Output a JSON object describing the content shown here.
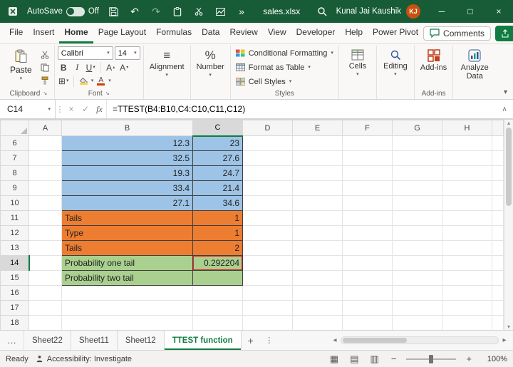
{
  "colors": {
    "title_green": "#185C37",
    "accent_green": "#107C41",
    "blue_fill": "#9DC3E6",
    "orange_fill": "#ED7D31",
    "green_fill": "#A9D08E",
    "highlight_red": "#ED1C24"
  },
  "icons": {
    "undo": "↶",
    "redo": "↷",
    "more_commands": "»",
    "chevron": "▾",
    "tri_up": "▴",
    "dots": "⋮",
    "ellipsis": "…",
    "plus": "+",
    "minus": "−",
    "arrow_left": "◂",
    "arrow_right": "▸",
    "check": "✓",
    "cancel": "×",
    "fx": "fx",
    "expand": "∧",
    "bold": "B",
    "italic": "I",
    "underline": "U",
    "borders": "⊞",
    "percent": "%",
    "align": "≡",
    "font_color": "A",
    "grow_font": "A",
    "shrink_font": "A",
    "launcher": "↘",
    "view_normal": "▦",
    "view_layout": "▤",
    "view_break": "▥",
    "minimize": "─",
    "maximize": "□",
    "close": "×"
  },
  "title_bar": {
    "autosave_label": "AutoSave",
    "autosave_state": "Off",
    "file_name": "sales.xlsx",
    "user_name": "Kunal Jai Kaushik",
    "user_initials": "KJ"
  },
  "ribbon_tabs": {
    "items": [
      "File",
      "Insert",
      "Home",
      "Page Layout",
      "Formulas",
      "Data",
      "Review",
      "View",
      "Developer",
      "Help",
      "Power Pivot"
    ],
    "active": "Home",
    "comments_label": "Comments"
  },
  "ribbon": {
    "paste": "Paste",
    "clipboard_group": "Clipboard",
    "font_name": "Calibri",
    "font_size": "14",
    "font_group": "Font",
    "alignment": "Alignment",
    "number": "Number",
    "conditional_formatting": "Conditional Formatting",
    "format_as_table": "Format as Table",
    "cell_styles": "Cell Styles",
    "styles_group": "Styles",
    "cells": "Cells",
    "editing": "Editing",
    "add_ins": "Add-ins",
    "add_ins_group": "Add-ins",
    "analyze_data": "Analyze Data"
  },
  "formula_bar": {
    "name_box": "C14",
    "formula": "=TTEST(B4:B10,C4:C10,C11,C12)"
  },
  "grid": {
    "columns": [
      "A",
      "B",
      "C",
      "D",
      "E",
      "F",
      "G",
      "H"
    ],
    "selected_column": "C",
    "selected_cell": "C14",
    "rows": [
      {
        "num": 6,
        "b": "12.3",
        "c": "23",
        "style": "blue"
      },
      {
        "num": 7,
        "b": "32.5",
        "c": "27.6",
        "style": "blue"
      },
      {
        "num": 8,
        "b": "19.3",
        "c": "24.7",
        "style": "blue"
      },
      {
        "num": 9,
        "b": "33.4",
        "c": "21.4",
        "style": "blue"
      },
      {
        "num": 10,
        "b": "27.1",
        "c": "34.6",
        "style": "blue"
      },
      {
        "num": 11,
        "b": "Tails",
        "c": "1",
        "style": "orange"
      },
      {
        "num": 12,
        "b": "Type",
        "c": "1",
        "style": "orange"
      },
      {
        "num": 13,
        "b": "Tails",
        "c": "2",
        "style": "orange"
      },
      {
        "num": 14,
        "b": "Probability one tail",
        "c": "0.292204",
        "style": "green",
        "selected": true
      },
      {
        "num": 15,
        "b": "Probability two tail",
        "c": "",
        "style": "green"
      },
      {
        "num": 16,
        "b": "",
        "c": "",
        "style": "plain"
      },
      {
        "num": 17,
        "b": "",
        "c": "",
        "style": "plain"
      },
      {
        "num": 18,
        "b": "",
        "c": "",
        "style": "plain"
      }
    ]
  },
  "sheet_tabs": {
    "tabs": [
      "Sheet22",
      "Sheet11",
      "Sheet12",
      "TTEST function"
    ],
    "active": "TTEST function"
  },
  "status_bar": {
    "mode": "Ready",
    "accessibility": "Accessibility: Investigate",
    "zoom_level": "100%"
  }
}
